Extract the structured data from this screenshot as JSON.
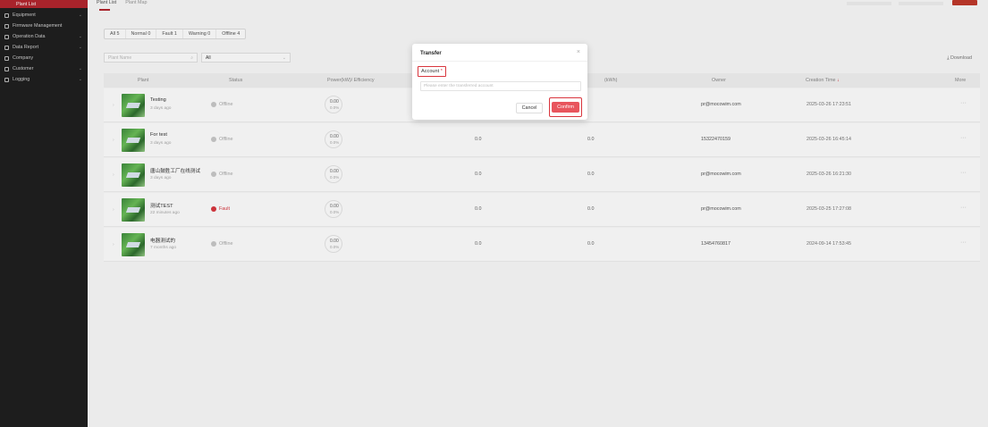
{
  "sidebar": {
    "items": [
      {
        "label": "Plant List",
        "icon": "list-icon"
      },
      {
        "label": "Equipment",
        "icon": "device-icon"
      },
      {
        "label": "Firmware Management",
        "icon": "firmware-icon"
      },
      {
        "label": "Operation Data",
        "icon": "data-icon"
      },
      {
        "label": "Data Report",
        "icon": "report-icon"
      },
      {
        "label": "Company",
        "icon": "company-icon"
      },
      {
        "label": "Customer",
        "icon": "customer-icon"
      },
      {
        "label": "Logging",
        "icon": "logging-icon"
      }
    ],
    "accent": "#b3262e"
  },
  "top_tabs": [
    "Plant List",
    "Plant Map"
  ],
  "filters": [
    "All 5",
    "Normal 0",
    "Fault 1",
    "Warning 0",
    "Offline 4"
  ],
  "search": {
    "placeholder": "Plant Name",
    "select_value": "All"
  },
  "download_label": "Download",
  "table": {
    "headers": {
      "plant": "Plant",
      "status": "Status",
      "efficiency": "Power(kW)/ Efficiency",
      "capacity": "(kWh)",
      "owner": "Owner",
      "creation": "Creation Time",
      "more": "More"
    },
    "rows": [
      {
        "name": "Testing",
        "ago": "3 days ago",
        "status": "Offline",
        "eff_value": "0.00",
        "eff_pct": "0.0%",
        "c1": "",
        "c2": "",
        "owner": "pr@mocowim.com",
        "ctime": "2025-03-26 17:23:51"
      },
      {
        "name": "For test",
        "ago": "3 days ago",
        "status": "Offline",
        "eff_value": "0.00",
        "eff_pct": "0.0%",
        "c1": "0.0",
        "c2": "0.0",
        "owner": "15322470159",
        "ctime": "2025-03-26 16:45:14"
      },
      {
        "name": "唐山鼓胜工厂在线测试",
        "ago": "3 days ago",
        "status": "Offline",
        "eff_value": "0.00",
        "eff_pct": "0.0%",
        "c1": "0.0",
        "c2": "0.0",
        "owner": "pr@mocowim.com",
        "ctime": "2025-03-26 16:21:30"
      },
      {
        "name": "测试TEST",
        "ago": "22 minutes ago",
        "status": "Fault",
        "eff_value": "0.00",
        "eff_pct": "0.0%",
        "c1": "0.0",
        "c2": "0.0",
        "owner": "pr@mocowim.com",
        "ctime": "2025-03-25 17:27:08"
      },
      {
        "name": "电器测试的",
        "ago": "7 months ago",
        "status": "Offline",
        "eff_value": "0.00",
        "eff_pct": "0.0%",
        "c1": "0.0",
        "c2": "0.0",
        "owner": "13454760817",
        "ctime": "2024-09-14 17:53:45"
      }
    ]
  },
  "modal": {
    "title": "Transfer",
    "field_label": "Account",
    "required_mark": "*",
    "placeholder": "Please enter the transferred account",
    "cancel": "Cancel",
    "confirm": "Confirm",
    "confirm_color": "#e8555d"
  }
}
